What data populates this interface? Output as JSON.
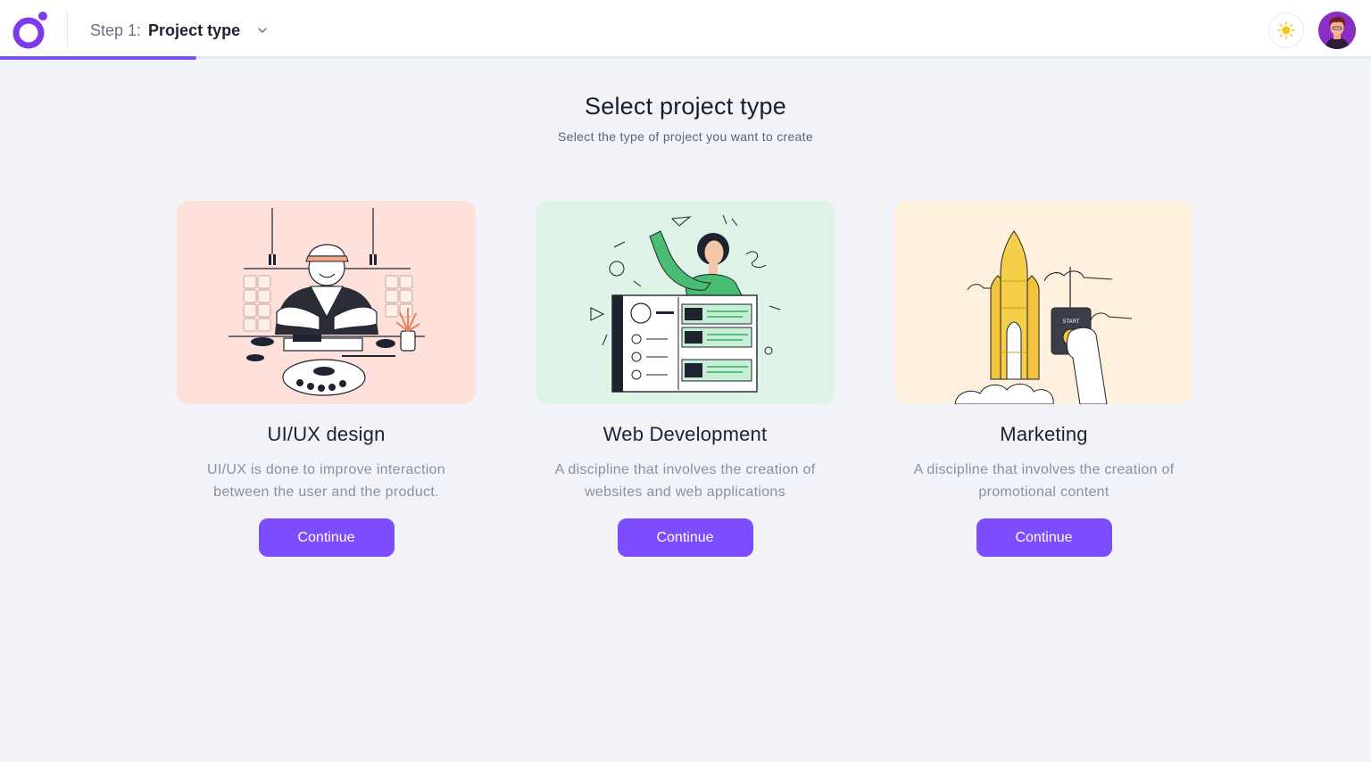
{
  "header": {
    "step_prefix": "Step 1:",
    "step_title": "Project type",
    "progress": 0.143,
    "accent_color": "#7c4dff"
  },
  "page": {
    "title": "Select project type",
    "subtitle": "Select the type of project you want to create"
  },
  "cards": [
    {
      "title": "UI/UX design",
      "description": "UI/UX is done to improve interaction between the user and the product.",
      "button": "Continue",
      "illustration": "sushi-chef-illustration",
      "bg_color": "#fde1da"
    },
    {
      "title": "Web Development",
      "description": "A discipline that involves the creation of websites and web applications",
      "button": "Continue",
      "illustration": "web-developer-illustration",
      "bg_color": "#ddf4e6"
    },
    {
      "title": "Marketing",
      "description": "A discipline that involves the creation of promotional content",
      "button": "Continue",
      "illustration": "rocket-launch-illustration",
      "bg_color": "#fdf0dd",
      "illustration_label": "START"
    }
  ]
}
